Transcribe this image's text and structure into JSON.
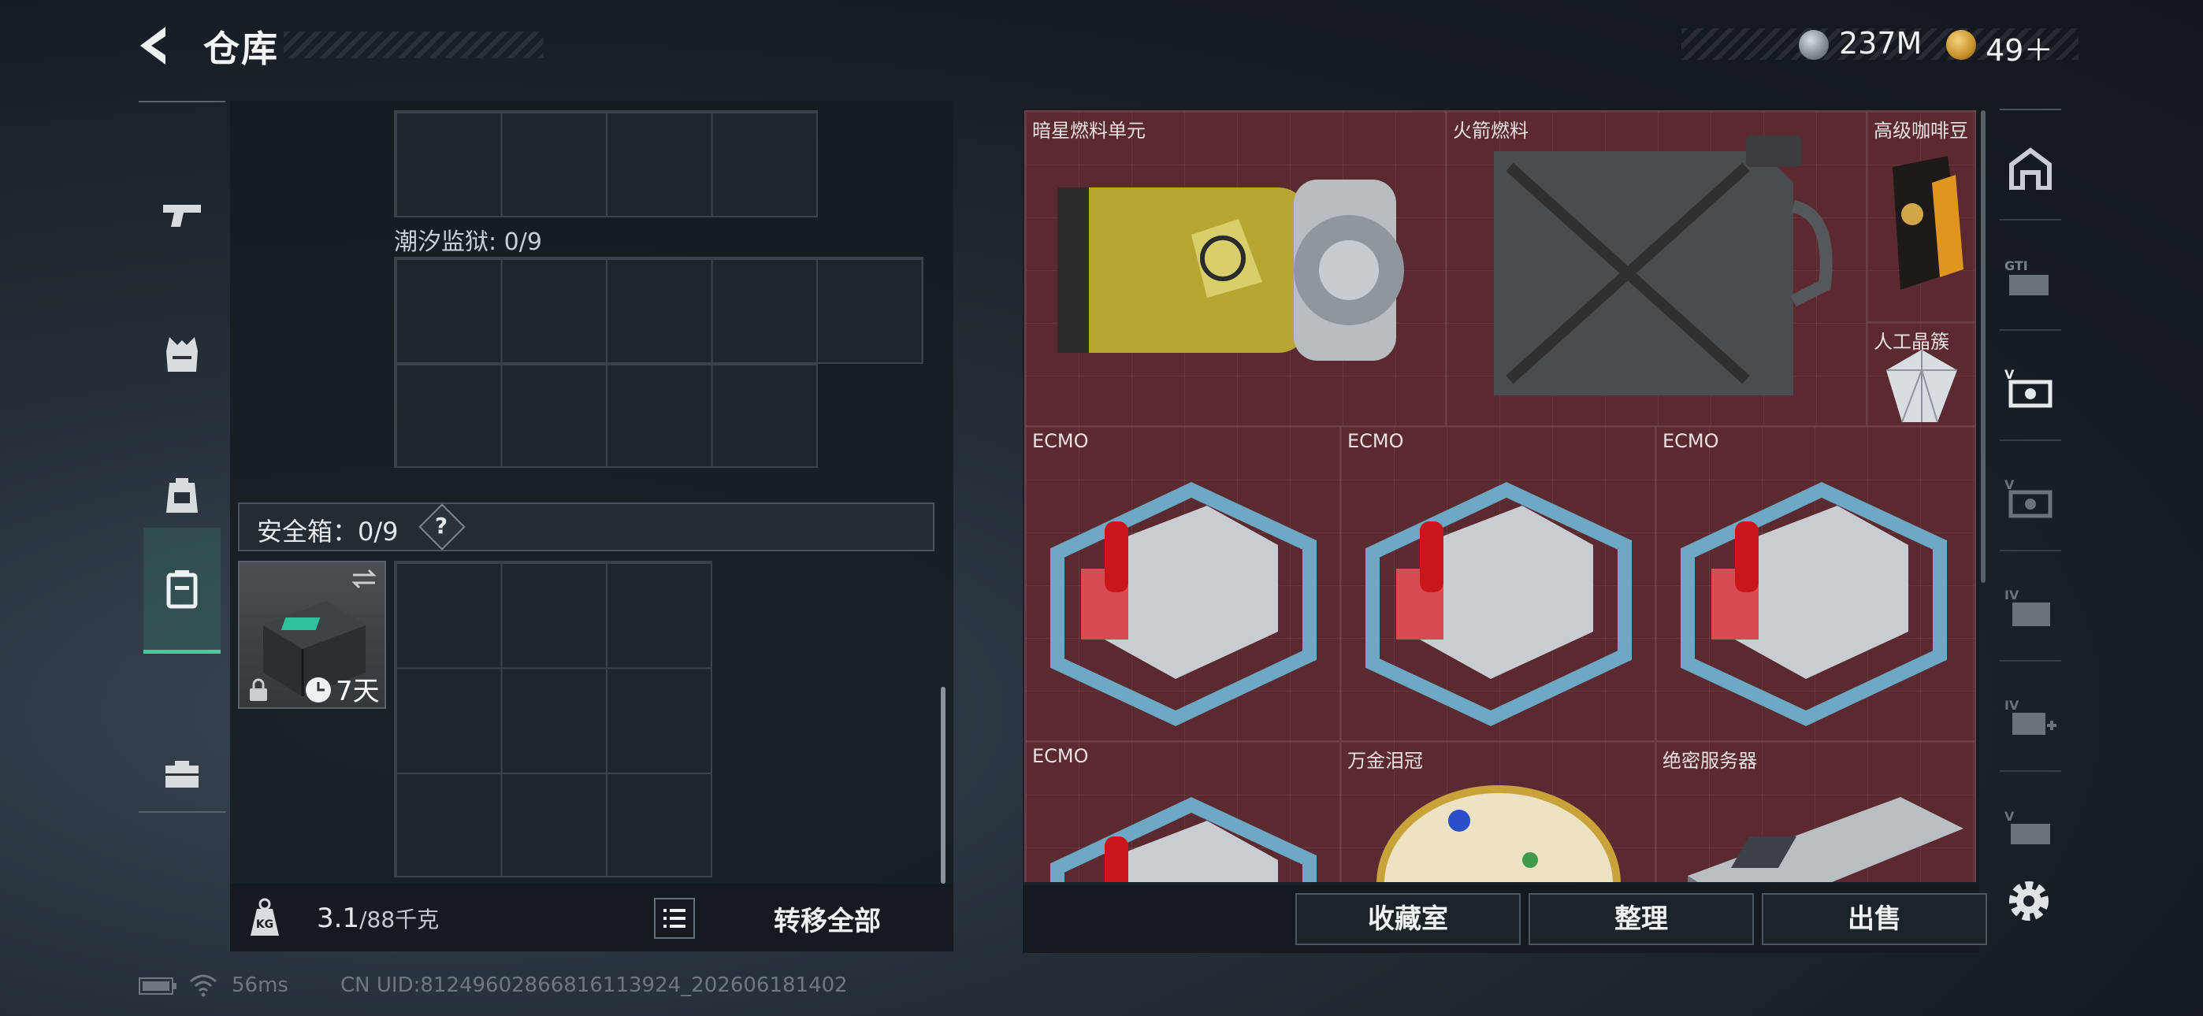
{
  "header": {
    "title": "仓库",
    "back_icon": "back-arrow-icon"
  },
  "currency": {
    "coins": "237M",
    "tokens": "49＋"
  },
  "left_categories": [
    {
      "name": "pistol-icon"
    },
    {
      "name": "vest-icon"
    },
    {
      "name": "backpack-icon"
    },
    {
      "name": "safebox-icon",
      "selected": true
    },
    {
      "name": "toolbox-icon"
    }
  ],
  "containers": {
    "tide_prison": {
      "label": "潮汐监狱: 0/9"
    },
    "safebox": {
      "label": "安全箱：0/9",
      "help": "?",
      "item_days": "7天"
    }
  },
  "footer_left": {
    "weight_value": "3.1",
    "weight_unit": "/88千克",
    "transfer_all": "转移全部"
  },
  "storage_items": [
    {
      "name": "暗星燃料单元"
    },
    {
      "name": "火箭燃料"
    },
    {
      "name": "高级咖啡豆"
    },
    {
      "name": "人工晶簇"
    },
    {
      "name": "ECMO"
    },
    {
      "name": "ECMO"
    },
    {
      "name": "ECMO"
    },
    {
      "name": "ECMO"
    },
    {
      "name": "万金泪冠"
    },
    {
      "name": "绝密服务器"
    }
  ],
  "footer_right": {
    "collection_room": "收藏室",
    "organize": "整理",
    "sell": "出售"
  },
  "right_tabs": [
    "home-tab-icon",
    "gti-tab-icon",
    "v-tab-icon",
    "v-tab-2-icon",
    "iv-tab-icon",
    "iv-add-tab-icon",
    "v-tab-3-icon"
  ],
  "status": {
    "ping": "56ms",
    "uid": "CN UID:81249602866816113924_202606181402"
  },
  "colors": {
    "accent_green": "#3fcf9e",
    "storage_cell": "#5b2a31"
  }
}
